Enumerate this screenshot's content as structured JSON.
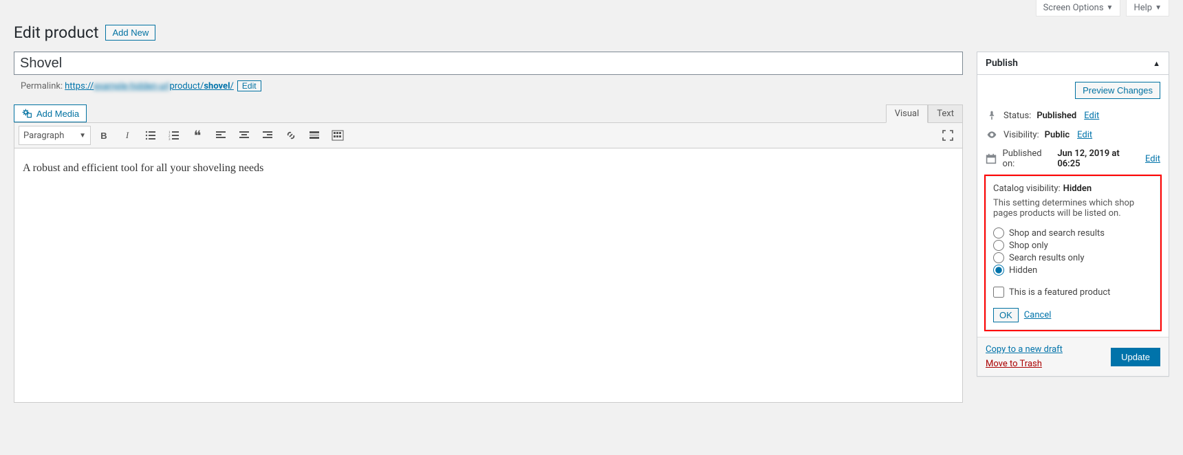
{
  "top": {
    "screen_options": "Screen Options",
    "help": "Help"
  },
  "page": {
    "title": "Edit product",
    "add_new": "Add New"
  },
  "product": {
    "title_value": "Shovel",
    "permalink_label": "Permalink:",
    "permalink_prefix": "https://",
    "permalink_blur": "example-hidden-url",
    "permalink_path": "product/",
    "permalink_slug": "shovel",
    "permalink_trail": "/",
    "edit_btn": "Edit",
    "description": "A robust and efficient tool for all your shoveling needs"
  },
  "editor": {
    "add_media": "Add Media",
    "tab_visual": "Visual",
    "tab_text": "Text",
    "format": "Paragraph"
  },
  "publish": {
    "box_title": "Publish",
    "preview_btn": "Preview Changes",
    "status_label": "Status:",
    "status_value": "Published",
    "edit": "Edit",
    "visibility_label": "Visibility:",
    "visibility_value": "Public",
    "published_label": "Published on:",
    "published_value": "Jun 12, 2019 at 06:25",
    "copy_link": "Copy to a new draft",
    "trash_link": "Move to Trash",
    "update_btn": "Update"
  },
  "catalog": {
    "title_label": "Catalog visibility:",
    "title_value": "Hidden",
    "description": "This setting determines which shop pages products will be listed on.",
    "options": {
      "shop_search": "Shop and search results",
      "shop_only": "Shop only",
      "search_only": "Search results only",
      "hidden": "Hidden"
    },
    "featured": "This is a featured product",
    "ok": "OK",
    "cancel": "Cancel"
  }
}
